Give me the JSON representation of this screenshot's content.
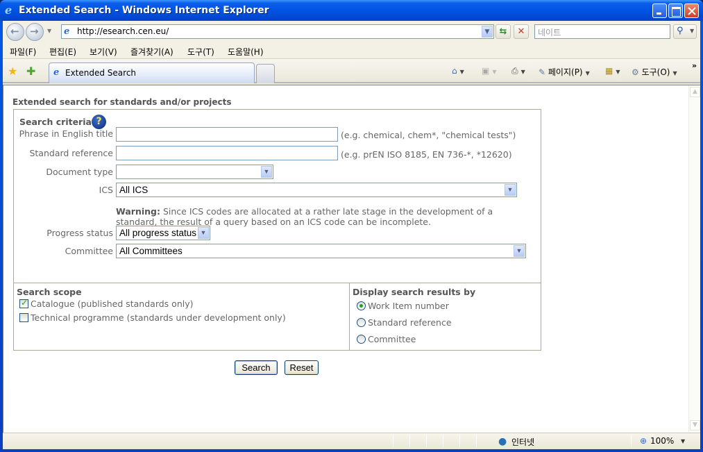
{
  "window": {
    "title": "Extended Search - Windows Internet Explorer"
  },
  "navbar": {
    "url": "http://esearch.cen.eu/",
    "search_placeholder": "네이트"
  },
  "menubar": {
    "items": [
      "파일(F)",
      "편집(E)",
      "보기(V)",
      "즐겨찾기(A)",
      "도구(T)",
      "도움말(H)"
    ]
  },
  "tabbar": {
    "active_tab": "Extended Search",
    "tools": {
      "page": "페이지(P)",
      "tools": "도구(O)"
    }
  },
  "page": {
    "title": "Extended search for standards and/or projects",
    "criteria": {
      "heading": "Search criteria",
      "phrase_label": "Phrase in English title",
      "phrase_value": "",
      "phrase_hint": "(e.g. chemical, chem*, \"chemical tests\")",
      "stdref_label": "Standard reference",
      "stdref_value": "",
      "stdref_hint": "(e.g. prEN ISO 8185, EN 736-*, *12620)",
      "doctype_label": "Document type",
      "doctype_value": "",
      "ics_label": "ICS",
      "ics_value": "All ICS",
      "warning_bold": "Warning:",
      "warning_text": " Since ICS codes are allocated at a rather late stage in the development of a standard, the result of a query based on an ICS code can be incomplete.",
      "progress_label": "Progress status",
      "progress_value": "All progress status",
      "committee_label": "Committee",
      "committee_value": "All Committees"
    },
    "scope": {
      "heading": "Search scope",
      "options": [
        {
          "label": "Catalogue (published standards only)",
          "checked": true
        },
        {
          "label": "Technical programme (standards under development only)",
          "checked": false
        }
      ]
    },
    "display": {
      "heading": "Display search results by",
      "options": [
        {
          "label": "Work Item number",
          "selected": true
        },
        {
          "label": "Standard reference",
          "selected": false
        },
        {
          "label": "Committee",
          "selected": false
        }
      ]
    },
    "buttons": {
      "search": "Search",
      "reset": "Reset"
    }
  },
  "statusbar": {
    "zone": "인터넷",
    "zoom": "100%"
  }
}
